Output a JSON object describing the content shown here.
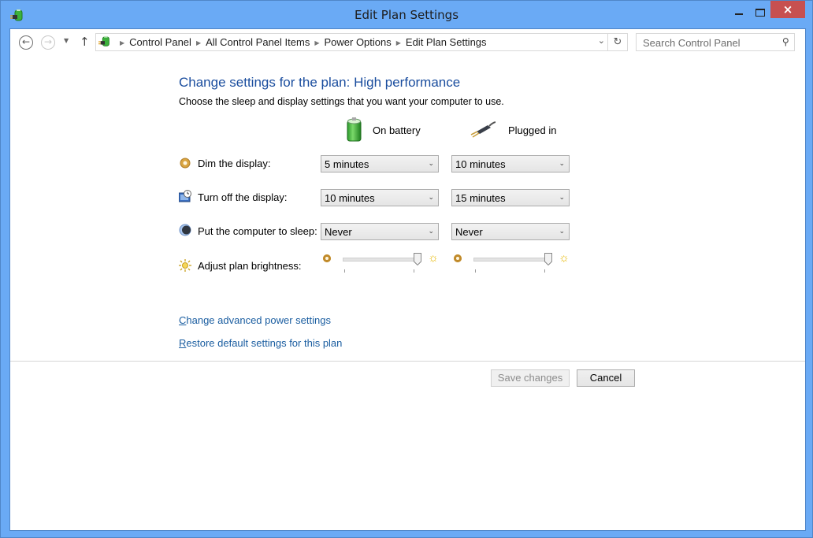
{
  "window": {
    "title": "Edit Plan Settings",
    "controls": {
      "minimize": "minimize",
      "maximize": "maximize",
      "close": "×"
    }
  },
  "nav": {
    "back_icon": "←",
    "forward_icon": "→",
    "recent_icon": "▼",
    "up_icon": "↑",
    "breadcrumbs": [
      "Control Panel",
      "All Control Panel Items",
      "Power Options",
      "Edit Plan Settings"
    ],
    "separator": "▶",
    "dropdown_icon": "⌄",
    "refresh_icon": "↻",
    "search_placeholder": "Search Control Panel",
    "search_icon": "⚲"
  },
  "content": {
    "heading": "Change settings for the plan: High performance",
    "subheading": "Choose the sleep and display settings that you want your computer to use.",
    "columns": {
      "battery": "On battery",
      "plugged": "Plugged in"
    },
    "settings": [
      {
        "label": "Dim the display:",
        "on_battery": "5 minutes",
        "plugged_in": "10 minutes"
      },
      {
        "label": "Turn off the display:",
        "on_battery": "10 minutes",
        "plugged_in": "15 minutes"
      },
      {
        "label": "Put the computer to sleep:",
        "on_battery": "Never",
        "plugged_in": "Never"
      }
    ],
    "brightness": {
      "label": "Adjust plan brightness:",
      "on_battery_percent": 100,
      "plugged_in_percent": 100
    },
    "select_arrow": "⌄",
    "links": {
      "advanced": {
        "accel": "C",
        "rest": "hange advanced power settings"
      },
      "restore": {
        "accel": "R",
        "rest": "estore default settings for this plan"
      }
    },
    "buttons": {
      "save": "Save changes",
      "cancel": "Cancel"
    }
  },
  "colors": {
    "frame": "#6aaaf5",
    "close": "#c75050",
    "heading": "#1a4d9e",
    "link": "#1a5da0"
  }
}
